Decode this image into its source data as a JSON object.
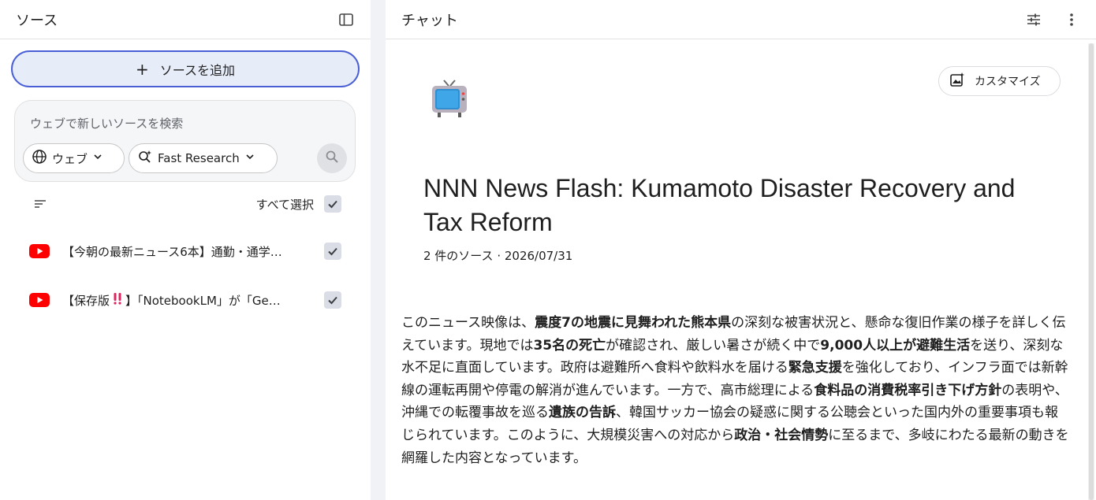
{
  "left_panel": {
    "title": "ソース",
    "add_source_label": "ソースを追加",
    "search": {
      "placeholder": "ウェブで新しいソースを検索",
      "chip_web": "ウェブ",
      "chip_fast": "Fast Research"
    },
    "select_all_label": "すべて選択",
    "sources": [
      {
        "title": "【今朝の最新ニュース6本】通勤・通学…"
      },
      {
        "title_prefix": "【保存版",
        "title_suffix": "】「NotebookLM」が「Ge…"
      }
    ]
  },
  "right_panel": {
    "title": "チャット",
    "customize_label": "カスタマイズ",
    "doc_title": "NNN News Flash: Kumamoto Disaster Recovery and Tax Reform",
    "doc_meta": "2 件のソース · 2026/07/31",
    "summary": [
      {
        "t": "このニュース映像は、"
      },
      {
        "t": "震度7の地震に見舞われた熊本県",
        "b": true
      },
      {
        "t": "の深刻な被害状況と、懸命な復旧作業の様子を詳しく伝えています。現地では"
      },
      {
        "t": "35名の死亡",
        "b": true
      },
      {
        "t": "が確認され、厳しい暑さが続く中で"
      },
      {
        "t": "9,000人以上が避難生活",
        "b": true
      },
      {
        "t": "を送り、深刻な水不足に直面しています。政府は避難所へ食料や飲料水を届ける"
      },
      {
        "t": "緊急支援",
        "b": true
      },
      {
        "t": "を強化しており、インフラ面では新幹線の運転再開や停電の解消が進んでいます。一方で、高市総理による"
      },
      {
        "t": "食料品の消費税率引き下げ方針",
        "b": true
      },
      {
        "t": "の表明や、沖縄での転覆事故を巡る"
      },
      {
        "t": "遺族の告訴",
        "b": true
      },
      {
        "t": "、韓国サッカー協会の疑惑に関する公聴会といった国内外の重要事項も報じられています。このように、大規模災害への対応から"
      },
      {
        "t": "政治・社会情勢",
        "b": true
      },
      {
        "t": "に至るまで、多岐にわたる最新の動きを網羅した内容となっています。"
      }
    ]
  },
  "colors": {
    "accent_border": "#4a5fd6",
    "add_button_bg": "#e6ecf8",
    "youtube_red": "#ff0000",
    "checkbox_bg": "#dadce6"
  },
  "icons": {
    "left_header": "panel-toggle-icon",
    "right_header": [
      "tune-icon",
      "more-vert-icon"
    ],
    "source": "youtube-icon",
    "chip_web": "globe-icon",
    "chip_fast": "sparkle-search-icon",
    "search_go": "search-icon",
    "customize": "image-sparkle-icon",
    "doc": "tv-emoji-icon"
  }
}
